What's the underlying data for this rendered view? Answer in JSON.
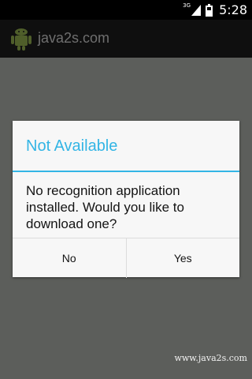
{
  "status_bar": {
    "network_type": "3G",
    "time": "5:28"
  },
  "action_bar": {
    "app_title": "java2s.com",
    "icon": "android-icon"
  },
  "dialog": {
    "title": "Not Available",
    "message": "No recognition application installed.  Would you like to download one?",
    "negative_label": "No",
    "positive_label": "Yes"
  },
  "watermark": "www.java2s.com",
  "colors": {
    "accent": "#33b5e5",
    "scrim": "#5c5e5b",
    "dialog_bg": "#f7f7f7"
  }
}
